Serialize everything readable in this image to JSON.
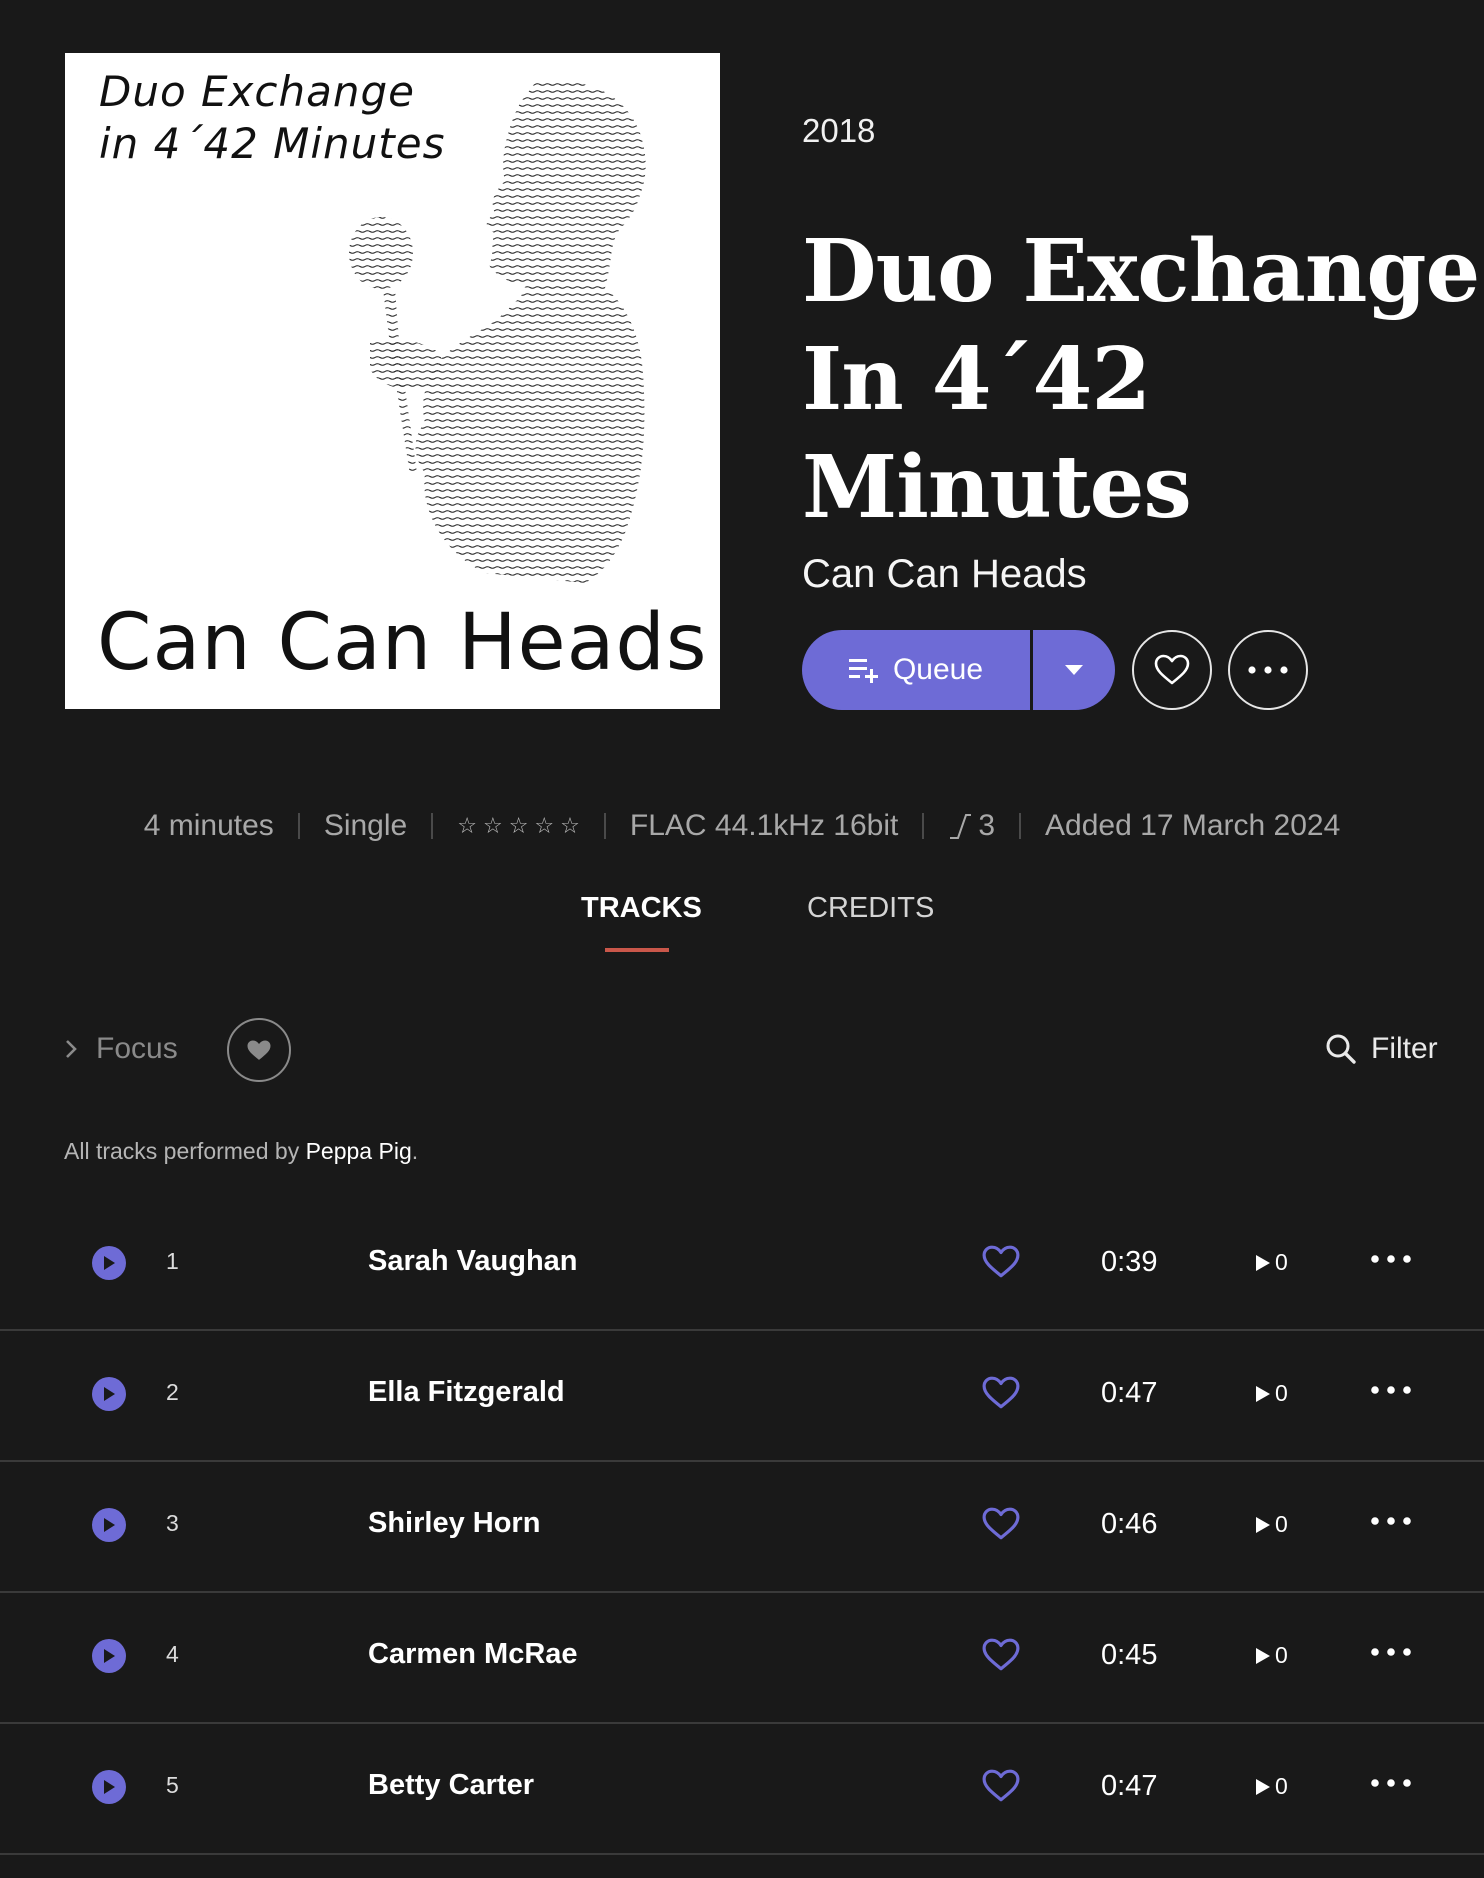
{
  "album": {
    "cover_line1": "Duo Exchange",
    "cover_line2": "in 4´42 Minutes",
    "cover_artist": "Can Can Heads",
    "year": "2018",
    "title_lines": [
      "Duo Exchange",
      "In 4´42",
      "Minutes"
    ],
    "artist": "Can Can Heads"
  },
  "actions": {
    "queue_label": "Queue",
    "accent": "#6e6bd6"
  },
  "meta": {
    "duration": "4 minutes",
    "type": "Single",
    "rating_stars": 5,
    "format": "FLAC 44.1kHz 16bit",
    "versions": "3",
    "added": "Added 17 March 2024"
  },
  "tabs": {
    "tracks": "TRACKS",
    "credits": "CREDITS",
    "active": "tracks"
  },
  "toolbar": {
    "focus": "Focus",
    "filter": "Filter"
  },
  "performed": {
    "prefix": "All tracks performed by ",
    "name": "Peppa Pig",
    "suffix": "."
  },
  "tracks": [
    {
      "num": "1",
      "title": "Sarah Vaughan",
      "duration": "0:39",
      "plays": "0"
    },
    {
      "num": "2",
      "title": "Ella Fitzgerald",
      "duration": "0:47",
      "plays": "0"
    },
    {
      "num": "3",
      "title": "Shirley Horn",
      "duration": "0:46",
      "plays": "0"
    },
    {
      "num": "4",
      "title": "Carmen McRae",
      "duration": "0:45",
      "plays": "0"
    },
    {
      "num": "5",
      "title": "Betty Carter",
      "duration": "0:47",
      "plays": "0"
    }
  ]
}
